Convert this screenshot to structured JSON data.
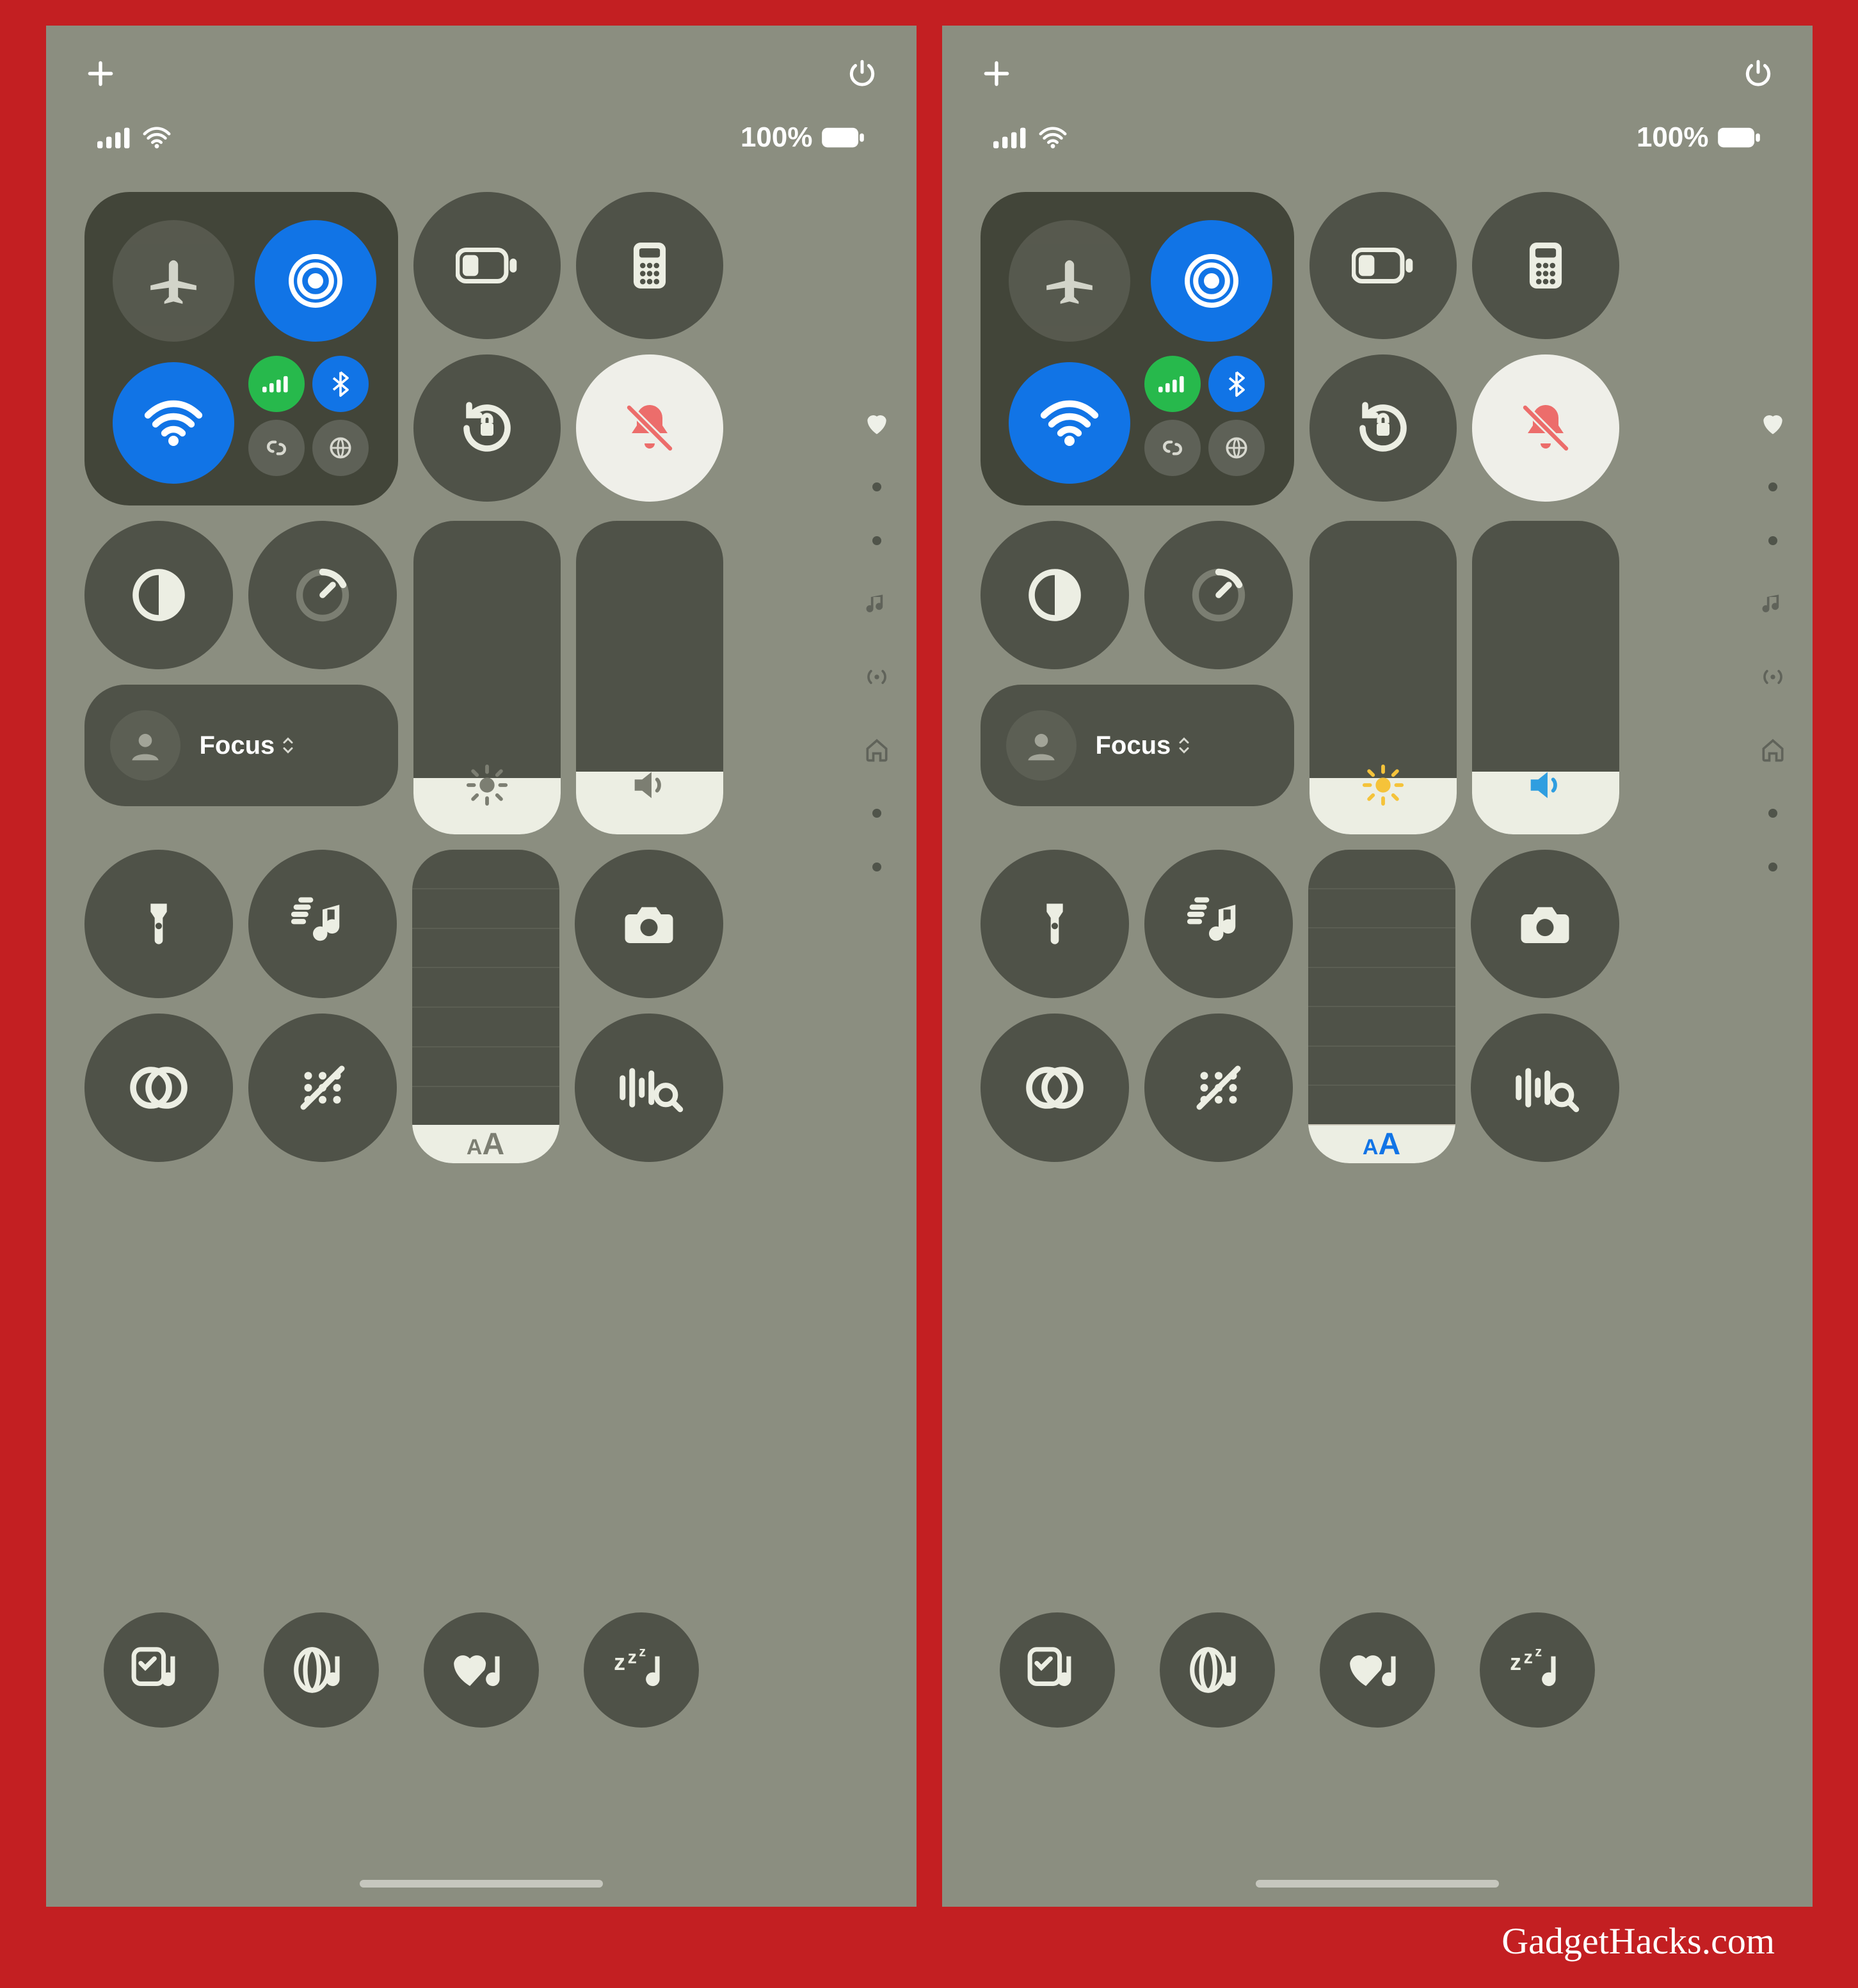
{
  "status": {
    "battery_pct": "100%"
  },
  "focus": {
    "label": "Focus"
  },
  "text_size": {
    "label": "AA"
  },
  "colors": {
    "accent_blue": "#1174e6",
    "accent_green": "#27b94c",
    "brightness_icon_tinted": "#f5c33a",
    "volume_icon_tinted": "#2f9ee0",
    "textsize_tinted": "#1174e6",
    "silent_bell": "#ec6d6b"
  },
  "icons": {
    "add": "plus",
    "power": "power",
    "airplane": "airplane",
    "airdrop": "airdrop",
    "wifi": "wifi",
    "cellular": "cellular-bars",
    "bluetooth": "bluetooth",
    "hotspot": "link",
    "satellite": "globe",
    "low_power": "battery",
    "calculator": "calculator",
    "rotation_lock": "rotation-lock",
    "silent": "bell-slash",
    "dark_mode": "half-moon-contrast",
    "timer": "timer",
    "brightness": "sun",
    "volume": "speaker",
    "flashlight": "flashlight",
    "music_recognition": "music-wave",
    "camera": "camera",
    "accessibility": "overlap-circles",
    "live_captions": "dots-slash",
    "sound_recognition": "waveform-search",
    "quick_note_music": "checklist-music",
    "spatial_audio": "spatial-music",
    "heart_music": "heart-music",
    "sleep_music": "zzz-music",
    "favorites_page": "heart",
    "music_page": "music",
    "connectivity_page": "antenna",
    "home_page": "home"
  },
  "attribution": "GadgetHacks.com",
  "sliders": {
    "brightness_fill_pct": 18,
    "volume_fill_pct": 20,
    "text_size_segments": 8,
    "text_size_filled": 1
  },
  "variants": [
    {
      "tinted": false
    },
    {
      "tinted": true
    }
  ]
}
